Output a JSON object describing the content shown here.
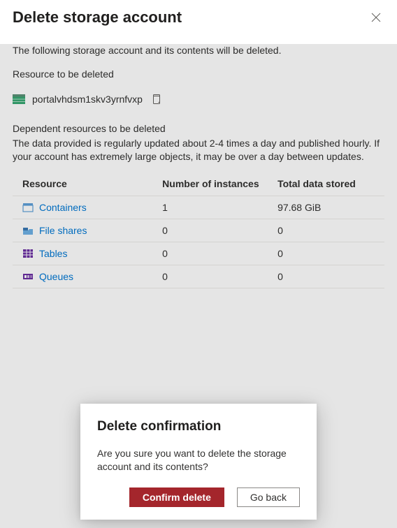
{
  "header": {
    "title": "Delete storage account"
  },
  "intro": "The following storage account and its contents will be deleted.",
  "resource": {
    "label": "Resource to be deleted",
    "name": "portalvhdsm1skv3yrnfvxp"
  },
  "dependent": {
    "label": "Dependent resources to be deleted",
    "description": "The data provided is regularly updated about 2-4 times a day and published hourly. If your account has extremely large objects, it may be over a day between updates.",
    "columns": [
      "Resource",
      "Number of instances",
      "Total data stored"
    ],
    "rows": [
      {
        "name": "Containers",
        "instances": "1",
        "stored": "97.68 GiB",
        "icon": "container"
      },
      {
        "name": "File shares",
        "instances": "0",
        "stored": "0",
        "icon": "fileshare"
      },
      {
        "name": "Tables",
        "instances": "0",
        "stored": "0",
        "icon": "table"
      },
      {
        "name": "Queues",
        "instances": "0",
        "stored": "0",
        "icon": "queue"
      }
    ]
  },
  "dialog": {
    "title": "Delete confirmation",
    "message": "Are you sure you want to delete the storage account and its contents?",
    "confirm_label": "Confirm delete",
    "cancel_label": "Go back"
  },
  "icons": {
    "container_color": "#0078d4",
    "fileshare_color": "#0078d4",
    "table_color": "#6b2fa3",
    "queue_color": "#6b2fa3",
    "storage_color": "#37a772"
  }
}
